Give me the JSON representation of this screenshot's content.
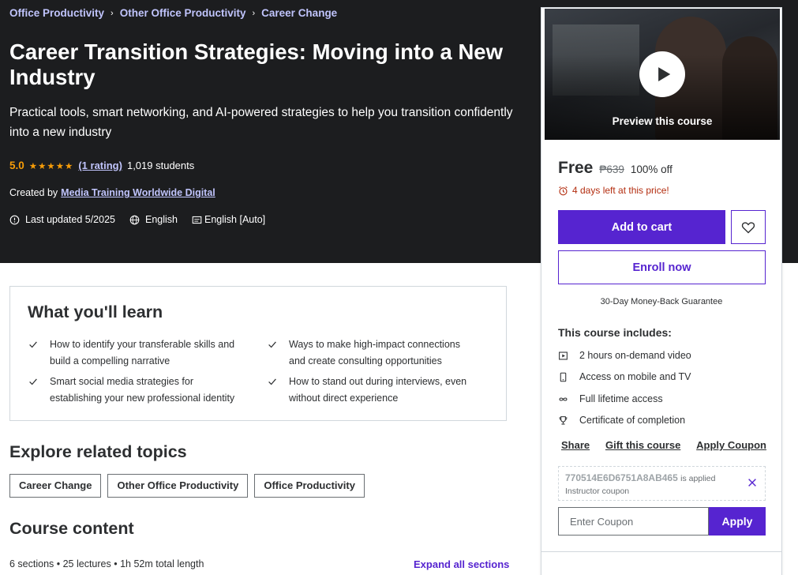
{
  "breadcrumb": [
    "Office Productivity",
    "Other Office Productivity",
    "Career Change"
  ],
  "course": {
    "title": "Career Transition Strategies: Moving into a New Industry",
    "subtitle": "Practical tools, smart networking, and AI-powered strategies to help you transition confidently into a new industry",
    "rating": "5.0",
    "stars": "★★★★★",
    "rating_count": "(1 rating)",
    "students": "1,019 students",
    "created_by_label": "Created by",
    "author": "Media Training Worldwide Digital",
    "last_updated": "Last updated 5/2025",
    "language": "English",
    "captions": "English [Auto]"
  },
  "learn": {
    "title": "What you'll learn",
    "items": [
      "How to identify your transferable skills and build a compelling narrative",
      "Ways to make high-impact connections and create consulting opportunities",
      "Smart social media strategies for establishing your new professional identity",
      "How to stand out during interviews, even without direct experience"
    ]
  },
  "topics": {
    "title": "Explore related topics",
    "items": [
      "Career Change",
      "Other Office Productivity",
      "Office Productivity"
    ]
  },
  "content": {
    "title": "Course content",
    "meta": "6 sections • 25 lectures • 1h 52m total length",
    "expand_label": "Expand all sections"
  },
  "sidebar": {
    "preview_label": "Preview this course",
    "price": "Free",
    "old_price": "₱639",
    "discount": "100% off",
    "timer": "4 days left at this price!",
    "add_to_cart": "Add to cart",
    "enroll": "Enroll now",
    "guarantee": "30-Day Money-Back Guarantee",
    "includes_title": "This course includes:",
    "includes": [
      {
        "icon": "video-icon",
        "text": "2 hours on-demand video"
      },
      {
        "icon": "mobile-icon",
        "text": "Access on mobile and TV"
      },
      {
        "icon": "infinity-icon",
        "text": "Full lifetime access"
      },
      {
        "icon": "trophy-icon",
        "text": "Certificate of completion"
      }
    ],
    "actions": [
      "Share",
      "Gift this course",
      "Apply Coupon"
    ],
    "coupon_code": "770514E6D6751A8AB465",
    "coupon_applied": "is applied",
    "coupon_type": "Instructor coupon",
    "coupon_placeholder": "Enter Coupon",
    "apply": "Apply"
  },
  "colors": {
    "header_bg": "#1c1d1f",
    "accent": "#5624d0",
    "link_light": "#c0c4fc",
    "star": "#f69c08",
    "timer": "#b32d0f"
  }
}
